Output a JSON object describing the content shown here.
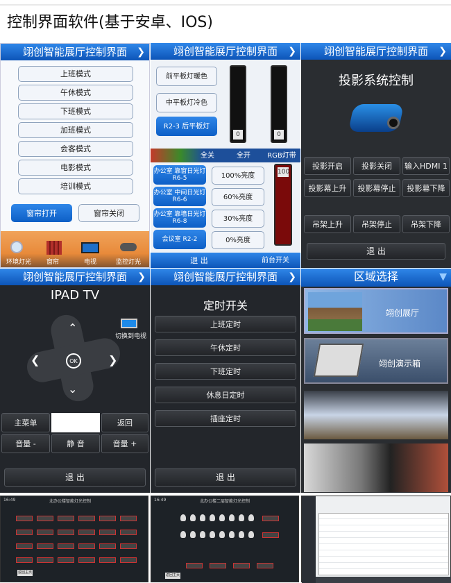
{
  "page_title": "控制界面软件(基于安卓、IOS)",
  "panel_header": "翊创智能展厅控制界面",
  "p1": {
    "modes": [
      "上班模式",
      "午休模式",
      "下班模式",
      "加班模式",
      "会客模式",
      "电影模式",
      "培训模式"
    ],
    "curtain_open": "窗帘打开",
    "curtain_close": "窗帘关闭",
    "tabs": [
      "环境灯光",
      "窗帘",
      "电视",
      "监控灯光"
    ]
  },
  "p2": {
    "lights": [
      "前平板灯暖色",
      "中平板灯冷色",
      "R2-3 后平板灯"
    ],
    "slider_values": [
      "0",
      "0"
    ],
    "bar": [
      "全关",
      "全开",
      "RGB灯带"
    ],
    "rooms": [
      "办公室 靠窗日光灯 R6-5",
      "办公室 中间日光灯 R6-6",
      "办公室 靠墙日光灯 R6-8",
      "会议室 R2-2"
    ],
    "levels": [
      "100%亮度",
      "60%亮度",
      "30%亮度",
      "0%亮度"
    ],
    "red_value": "100",
    "exit": "退 出",
    "front": "前台开关"
  },
  "p3": {
    "title": "投影系统控制",
    "buttons": [
      "投影开启",
      "投影关闭",
      "输入HDMI 1",
      "投影幕上升",
      "投影幕停止",
      "投影幕下降",
      "吊架上升",
      "吊架停止",
      "吊架下降"
    ],
    "exit": "退 出"
  },
  "p4": {
    "title": "IPAD TV",
    "switch": "切换到电视",
    "ok": "OK",
    "menu": "主菜单",
    "back": "返回",
    "vol_down": "音量 -",
    "mute": "静 音",
    "vol_up": "音量 +",
    "exit": "退 出"
  },
  "p5": {
    "title": "定时开关",
    "items": [
      "上班定时",
      "午休定时",
      "下班定时",
      "休息日定时",
      "插座定时"
    ],
    "exit": "退 出"
  },
  "p6": {
    "title": "区域选择",
    "items": [
      "翊创展厅",
      "翊创演示箱"
    ]
  },
  "bottom": {
    "s1_title": "北办公楼智能灯光控制",
    "s2_title": "北办公楼二层智能灯光控制",
    "s1_btn": "返回主页",
    "s2_btn": "返回主页",
    "time": "16:49"
  },
  "colors": {
    "blue": "#0d55b8",
    "dark": "#23262b"
  }
}
